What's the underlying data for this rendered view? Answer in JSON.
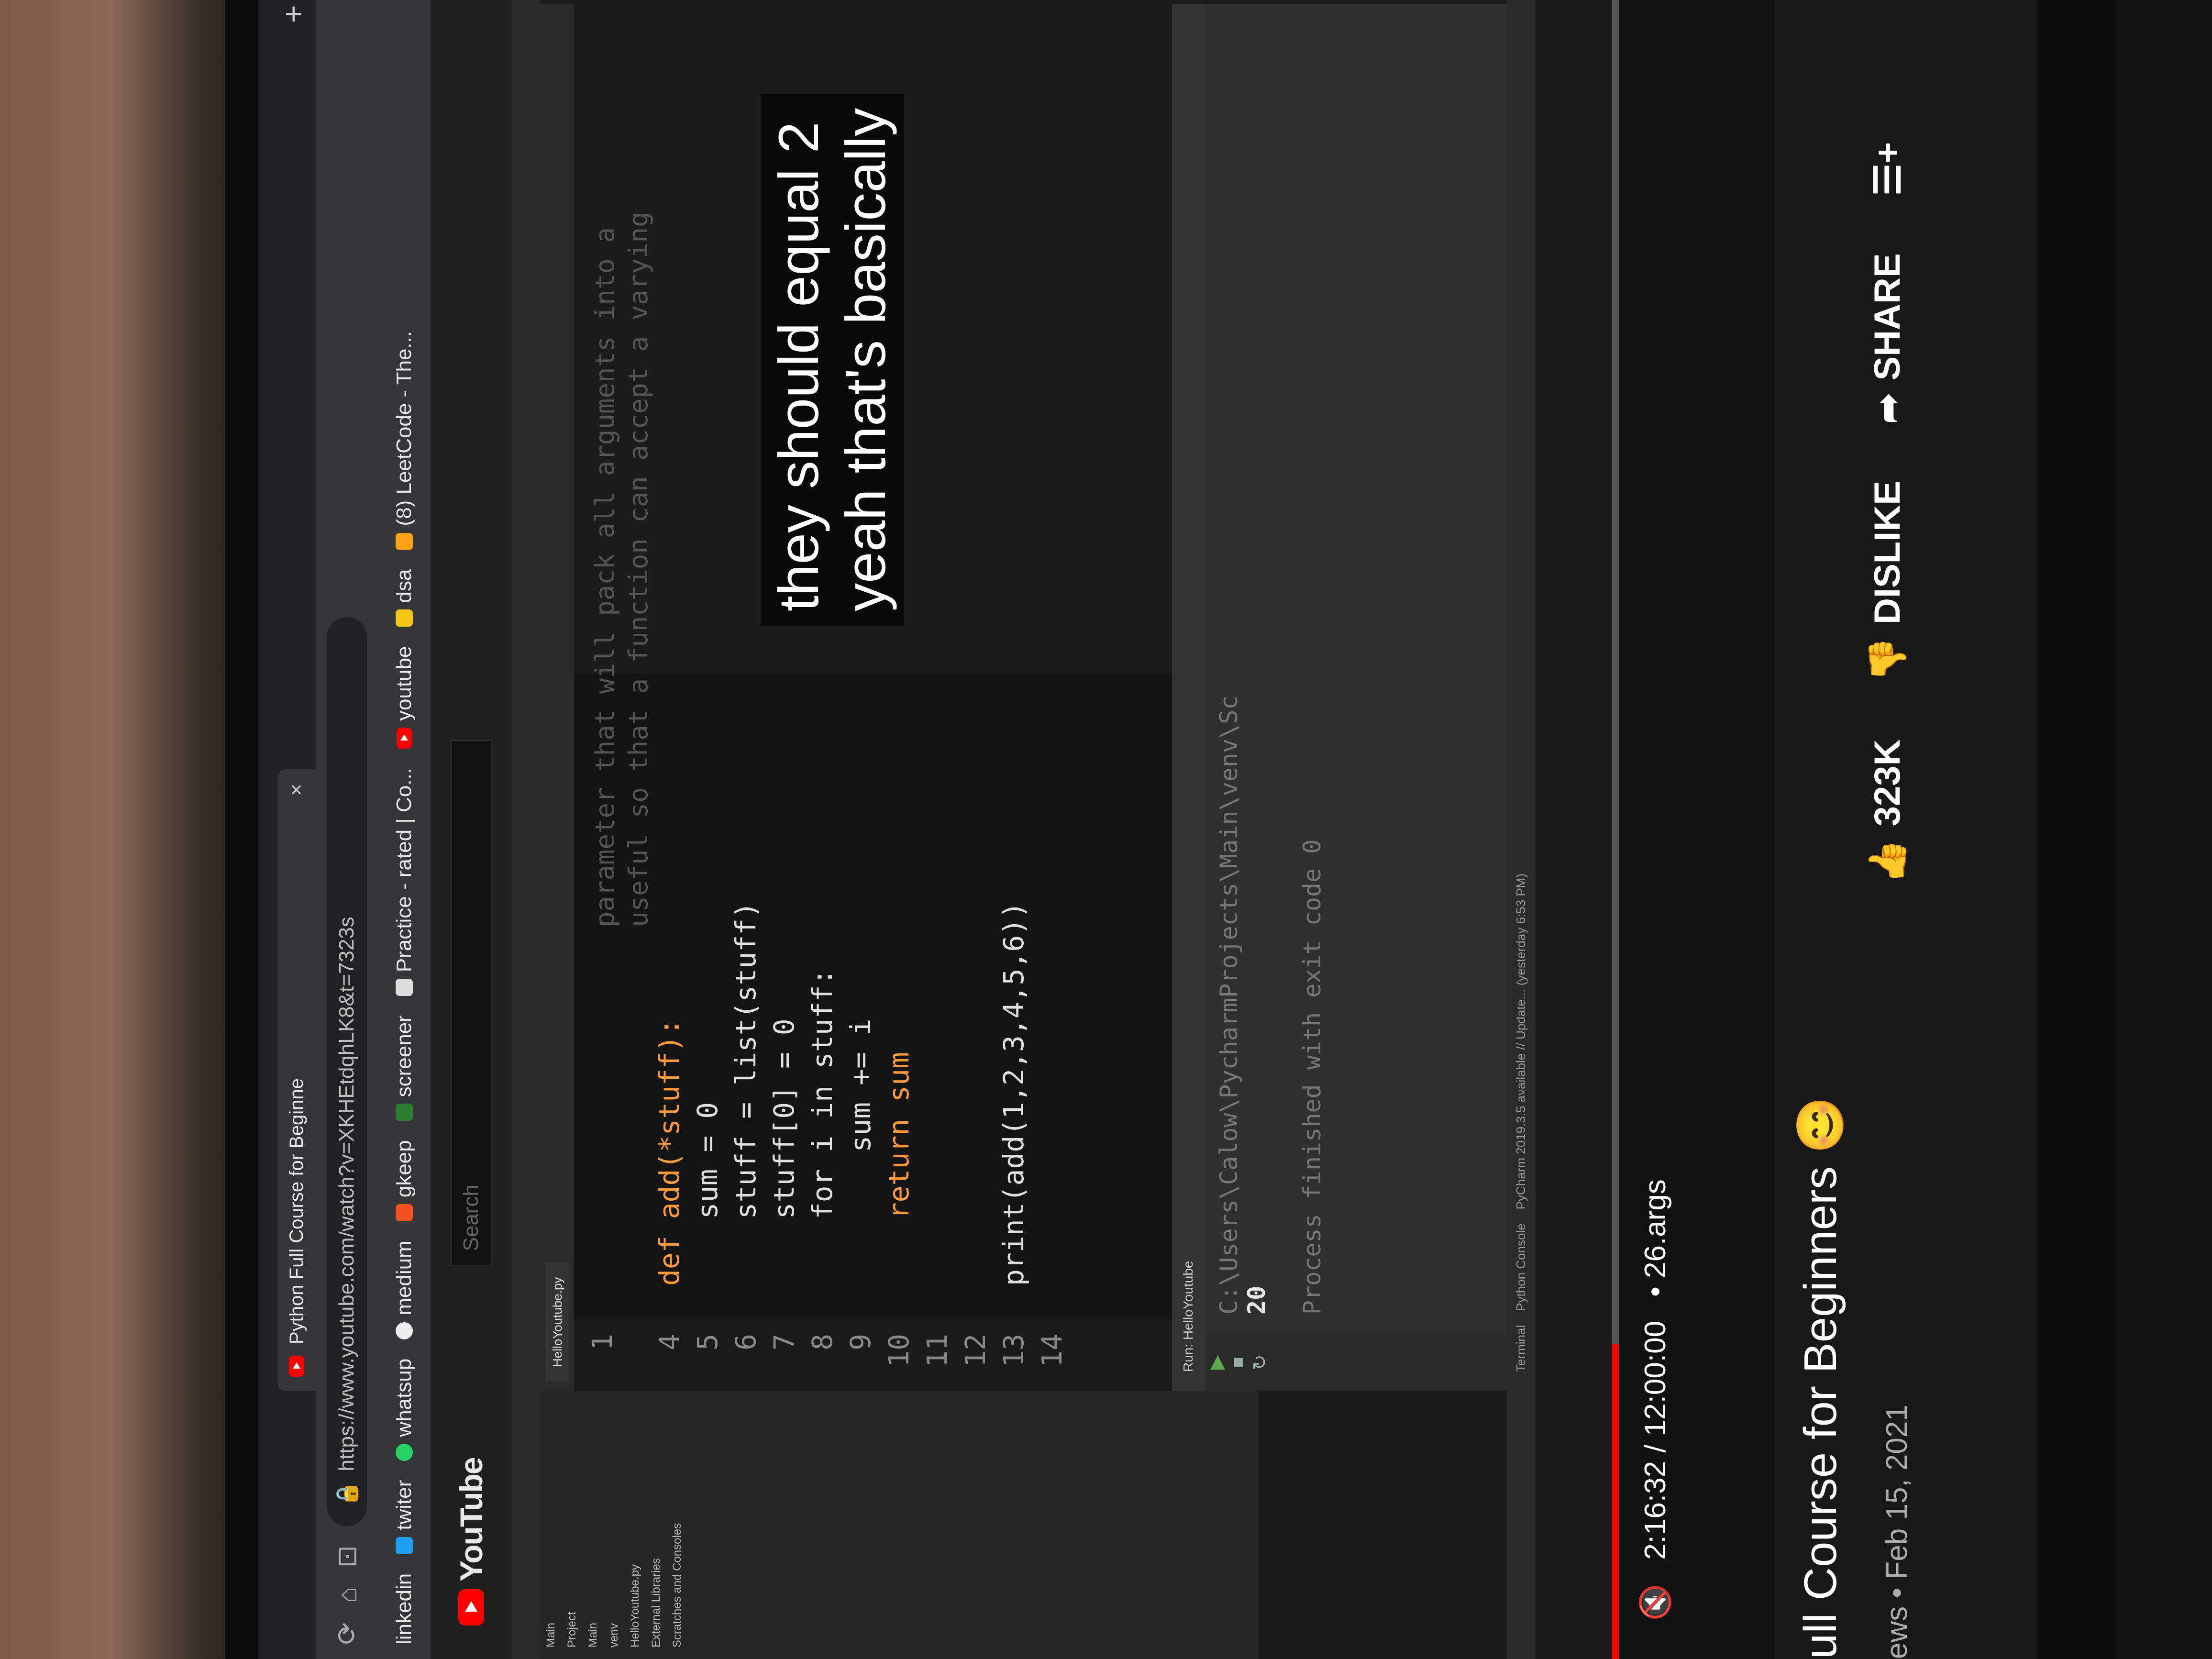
{
  "browser": {
    "tab_title": "Python Full Course for Beginne",
    "tab_close": "×",
    "new_tab": "+",
    "url": "https://www.youtube.com/watch?v=XKHEtdqhLK8&t=7323s",
    "bookmarks": [
      "linkedin",
      "twiter",
      "whatsup",
      "medium",
      "gkeep",
      "screener",
      "Practice - rated | Co...",
      "youtube",
      "dsa",
      "(8) LeetCode - The..."
    ]
  },
  "youtube": {
    "logo_text": "YouTube",
    "search_placeholder": "Search"
  },
  "ide": {
    "file_tab": "HelloYoutube.py",
    "project_items": [
      "Main",
      "Project",
      "Main",
      "venv",
      "HelloYoutube.py",
      "External Libraries",
      "Scratches and Consoles"
    ],
    "docstring": [
      "parameter that will pack all arguments into a",
      "useful so that a function can accept a varying"
    ],
    "code_lines": [
      {
        "num": "1",
        "code": ""
      },
      {
        "num": "4",
        "code": "def add(*stuff):"
      },
      {
        "num": "5",
        "code": "    sum = 0"
      },
      {
        "num": "6",
        "code": "    stuff = list(stuff)"
      },
      {
        "num": "7",
        "code": "    stuff[0] = 0"
      },
      {
        "num": "8",
        "code": "    for i in stuff:"
      },
      {
        "num": "9",
        "code": "        sum += i"
      },
      {
        "num": "10",
        "code": "    return sum"
      },
      {
        "num": "11",
        "code": ""
      },
      {
        "num": "12",
        "code": ""
      },
      {
        "num": "13",
        "code": "print(add(1,2,3,4,5,6))"
      },
      {
        "num": "14",
        "code": ""
      }
    ],
    "run_tab": "Run: HelloYoutube",
    "run_path": "C:\\Users\\Calow\\PycharmProjects\\Main\\venv\\Sc",
    "run_output": "20",
    "run_finished": "Process finished with exit code 0",
    "status_tabs": [
      "Terminal",
      "Python Console"
    ],
    "status_text": "PyCharm 2019.3.5 available // Update... (yesterday 6:53 PM)"
  },
  "player": {
    "subtitle": "they should equal 2\nyeah that's basically",
    "time": "2:16:32 / 12:00:00",
    "chapter": "• 26.args",
    "progress": 0.19
  },
  "video": {
    "title": "ull Course for Beginners",
    "meta": "ews • Feb 15, 2021",
    "likes": "323K",
    "dislike": "DISLIKE",
    "share": "SHARE"
  }
}
